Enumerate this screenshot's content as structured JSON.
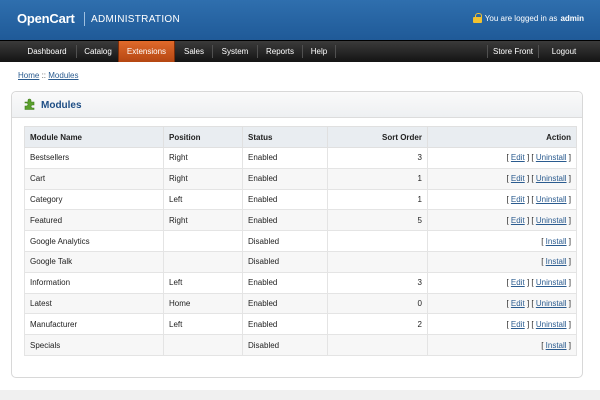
{
  "header": {
    "logo": "OpenCart",
    "subtitle": "ADMINISTRATION",
    "login_prefix": "You are logged in as",
    "login_user": "admin"
  },
  "menu": {
    "items": [
      {
        "label": "Dashboard"
      },
      {
        "label": "Catalog"
      },
      {
        "label": "Extensions",
        "active": true
      },
      {
        "label": "Sales"
      },
      {
        "label": "System"
      },
      {
        "label": "Reports"
      },
      {
        "label": "Help"
      }
    ],
    "right": [
      {
        "label": "Store Front"
      },
      {
        "label": "Logout"
      }
    ]
  },
  "breadcrumb": {
    "home": "Home",
    "separator": "::",
    "current": "Modules"
  },
  "box": {
    "title": "Modules"
  },
  "table": {
    "headers": [
      "Module Name",
      "Position",
      "Status",
      "Sort Order",
      "Action"
    ],
    "rows": [
      {
        "name": "Bestsellers",
        "position": "Right",
        "status": "Enabled",
        "sort": "3",
        "actions": [
          "Edit",
          "Uninstall"
        ]
      },
      {
        "name": "Cart",
        "position": "Right",
        "status": "Enabled",
        "sort": "1",
        "actions": [
          "Edit",
          "Uninstall"
        ]
      },
      {
        "name": "Category",
        "position": "Left",
        "status": "Enabled",
        "sort": "1",
        "actions": [
          "Edit",
          "Uninstall"
        ]
      },
      {
        "name": "Featured",
        "position": "Right",
        "status": "Enabled",
        "sort": "5",
        "actions": [
          "Edit",
          "Uninstall"
        ]
      },
      {
        "name": "Google Analytics",
        "position": "",
        "status": "Disabled",
        "sort": "",
        "actions": [
          "Install"
        ]
      },
      {
        "name": "Google Talk",
        "position": "",
        "status": "Disabled",
        "sort": "",
        "actions": [
          "Install"
        ]
      },
      {
        "name": "Information",
        "position": "Left",
        "status": "Enabled",
        "sort": "3",
        "actions": [
          "Edit",
          "Uninstall"
        ]
      },
      {
        "name": "Latest",
        "position": "Home",
        "status": "Enabled",
        "sort": "0",
        "actions": [
          "Edit",
          "Uninstall"
        ]
      },
      {
        "name": "Manufacturer",
        "position": "Left",
        "status": "Enabled",
        "sort": "2",
        "actions": [
          "Edit",
          "Uninstall"
        ]
      },
      {
        "name": "Specials",
        "position": "",
        "status": "Disabled",
        "sort": "",
        "actions": [
          "Install"
        ]
      }
    ]
  },
  "colors": {
    "header_blue": "#2f6fae",
    "menu_dark": "#1f1f1f",
    "active_orange": "#d35d22",
    "link_blue": "#2a5b8f"
  }
}
